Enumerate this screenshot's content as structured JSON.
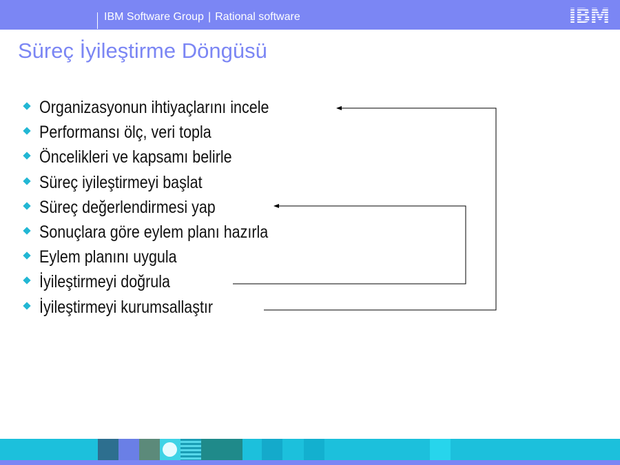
{
  "header": {
    "group": "IBM Software Group",
    "separator": "|",
    "product": "Rational software",
    "logo_text": "IBM"
  },
  "title": "Süreç İyileştirme Döngüsü",
  "bullets": [
    "Organizasyonun ihtiyaçlarını incele",
    "Performansı ölç, veri topla",
    "Öncelikleri ve kapsamı belirle",
    "Süreç iyileştirmeyi başlat",
    "Süreç değerlendirmesi yap",
    "Sonuçlara göre eylem planı hazırla",
    "Eylem planını uygula",
    "İyileştirmeyi doğrula",
    "İyileştirmeyi kurumsallaştır"
  ],
  "colors": {
    "brand_bar": "#7b86f4",
    "bullet": "#22b7d4",
    "footer_strip": "#1cc0dc"
  }
}
